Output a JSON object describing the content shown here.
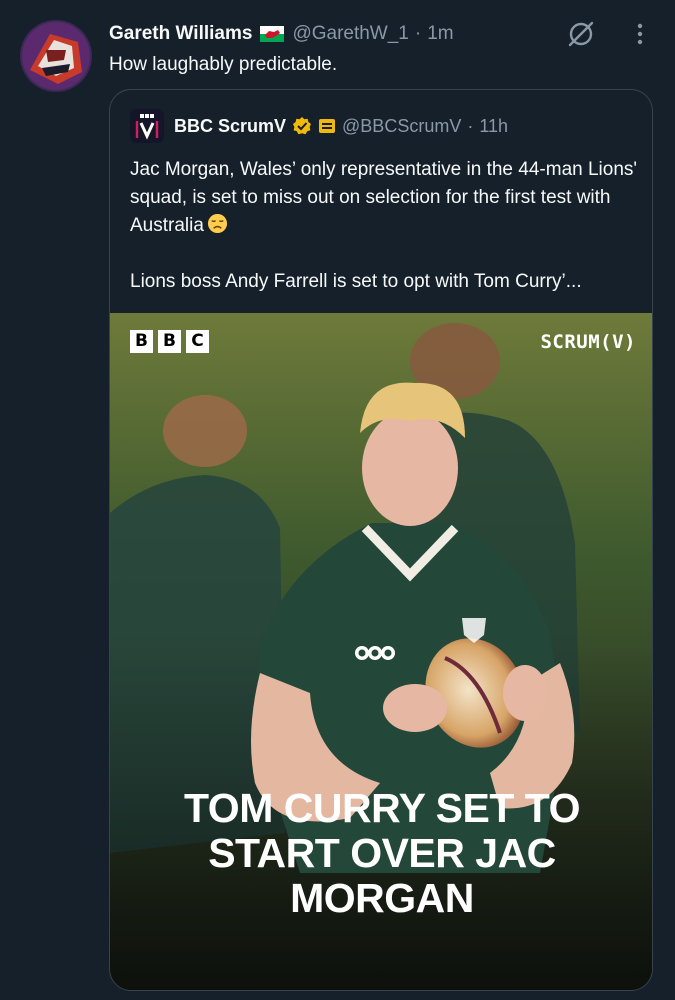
{
  "tweet": {
    "author": {
      "name": "Gareth Williams",
      "handle": "@GarethW_1",
      "time": "1m"
    },
    "text": "How laughably predictable.",
    "separator": "·"
  },
  "quoted_tweet": {
    "author": {
      "name": "BBC ScrumV",
      "handle": "@BBCScrumV",
      "time": "11h"
    },
    "separator": "·",
    "text_line1": "Jac Morgan, Wales’ only representative in the 44-man Lions' squad, is set to miss out on selection for the first test with Australia",
    "text_line2": "Lions boss Andy Farrell is set to opt with Tom Curry’...",
    "media": {
      "logo_left": [
        "B",
        "B",
        "C"
      ],
      "logo_right": "SCRUM(V)",
      "headline": [
        "TOM CURRY SET TO",
        "START OVER JAC",
        "MORGAN"
      ]
    }
  },
  "icons": {
    "flag": "wales-flag-icon",
    "grok": "grok-icon",
    "more": "more-options-icon",
    "verified": "verified-gold-badge-icon",
    "affiliate": "affiliate-badge-icon",
    "emoji": "disappointed-face-emoji"
  },
  "colors": {
    "background": "#15202b",
    "text": "#f7f9f9",
    "muted": "#8b98a5",
    "border": "#38444d",
    "gold_badge": "#f0b90b",
    "jersey": "#2d4b42"
  }
}
